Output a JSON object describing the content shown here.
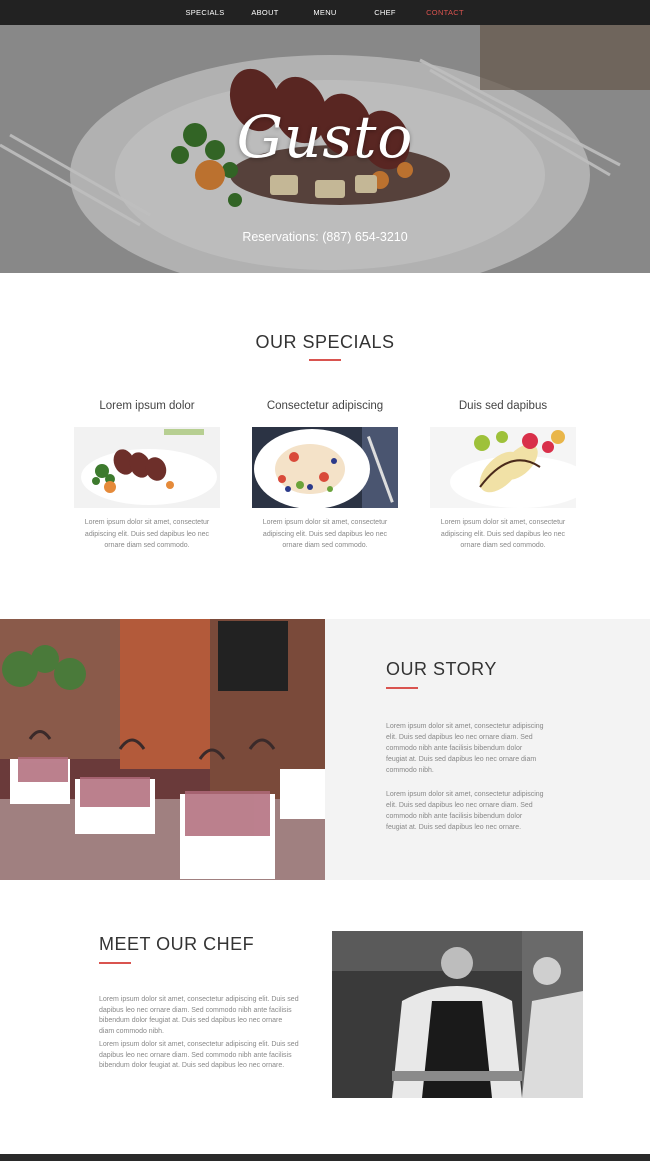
{
  "nav": {
    "items": [
      {
        "label": "SPECIALS"
      },
      {
        "label": "ABOUT"
      },
      {
        "label": "MENU"
      },
      {
        "label": "CHEF"
      },
      {
        "label": "CONTACT"
      }
    ],
    "active_color": "#d9534f"
  },
  "hero": {
    "title": "Gusto",
    "reservations": "Reservations: (887) 654-3210"
  },
  "specials": {
    "title": "OUR SPECIALS",
    "cards": [
      {
        "title": "Lorem ipsum dolor",
        "text": "Lorem ipsum dolor sit amet, consectetur adipiscing elit. Duis sed dapibus leo nec ornare diam sed commodo."
      },
      {
        "title": "Consectetur adipiscing",
        "text": "Lorem ipsum dolor sit amet, consectetur adipiscing elit. Duis sed dapibus leo nec ornare diam sed commodo."
      },
      {
        "title": "Duis sed dapibus",
        "text": "Lorem ipsum dolor sit amet, consectetur adipiscing elit. Duis sed dapibus leo nec ornare diam sed commodo."
      }
    ]
  },
  "story": {
    "title": "OUR STORY",
    "paragraphs": [
      "Lorem ipsum dolor sit amet, consectetur adipiscing elit. Duis sed dapibus leo nec ornare diam. Sed commodo nibh ante facilisis bibendum dolor feugiat at. Duis sed dapibus leo nec ornare diam commodo nibh.",
      "Lorem ipsum dolor sit amet, consectetur adipiscing elit. Duis sed dapibus leo nec ornare diam. Sed commodo nibh ante facilisis bibendum dolor feugiat at. Duis sed dapibus leo nec ornare."
    ]
  },
  "chef": {
    "title": "MEET OUR CHEF",
    "paragraphs": [
      "Lorem ipsum dolor sit amet, consectetur adipiscing elit. Duis sed dapibus leo nec ornare diam. Sed commodo nibh ante facilisis bibendum dolor feugiat at. Duis sed dapibus leo nec ornare diam commodo nibh.",
      "Lorem ipsum dolor sit amet, consectetur adipiscing elit. Duis sed dapibus leo nec ornare diam. Sed commodo nibh ante facilisis bibendum dolor feugiat at. Duis sed dapibus leo nec ornare."
    ]
  },
  "colors": {
    "accent": "#d9534f",
    "nav_bg": "#222222",
    "story_bg": "#f3f3f3"
  }
}
